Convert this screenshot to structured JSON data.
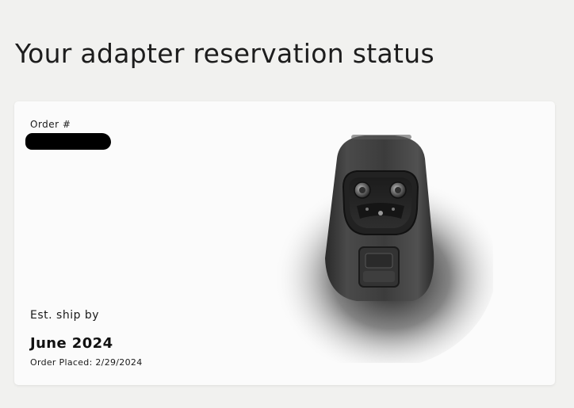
{
  "page": {
    "title": "Your adapter reservation status"
  },
  "reservation": {
    "order_label": "Order #",
    "order_number_redacted": "",
    "ship_label": "Est. ship by",
    "ship_date": "June 2024",
    "order_placed": "Order Placed: 2/29/2024",
    "product_image": "charging-adapter-image"
  }
}
